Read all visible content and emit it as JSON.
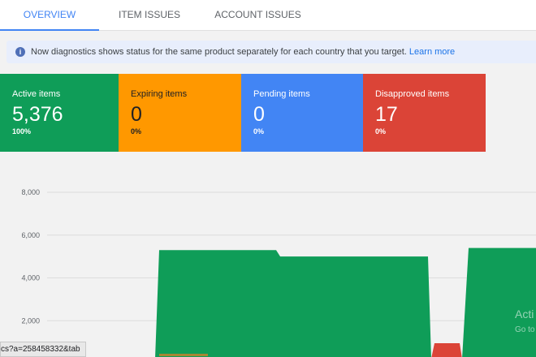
{
  "tabs": [
    {
      "label": "OVERVIEW",
      "active": true
    },
    {
      "label": "ITEM ISSUES",
      "active": false
    },
    {
      "label": "ACCOUNT ISSUES",
      "active": false
    }
  ],
  "banner": {
    "text": "Now diagnostics shows status for the same product separately for each country that you target.",
    "link": "Learn more"
  },
  "cards": [
    {
      "label": "Active items",
      "count": "5,376",
      "percent": "100%",
      "color": "#0f9d58"
    },
    {
      "label": "Expiring items",
      "count": "0",
      "percent": "0%",
      "color": "#ff9800"
    },
    {
      "label": "Pending items",
      "count": "0",
      "percent": "0%",
      "color": "#4285f4"
    },
    {
      "label": "Disapproved items",
      "count": "17",
      "percent": "0%",
      "color": "#db4437"
    }
  ],
  "chart_data": {
    "type": "area",
    "y_ticks": [
      "8,000",
      "6,000",
      "4,000",
      "2,000"
    ],
    "ylim": [
      0,
      9000
    ],
    "series": [
      {
        "color": "#0f9d58",
        "values": [
          0,
          5300,
          5300,
          5300,
          5000,
          5000,
          0,
          0,
          5400,
          5400
        ]
      },
      {
        "color": "#db4437",
        "values": [
          0,
          0,
          0,
          0,
          0,
          0,
          0,
          150,
          0,
          0
        ]
      }
    ]
  },
  "watermark": {
    "line1": "Acti",
    "line2": "Go to"
  },
  "status_url": "cs?a=258458332&tab"
}
